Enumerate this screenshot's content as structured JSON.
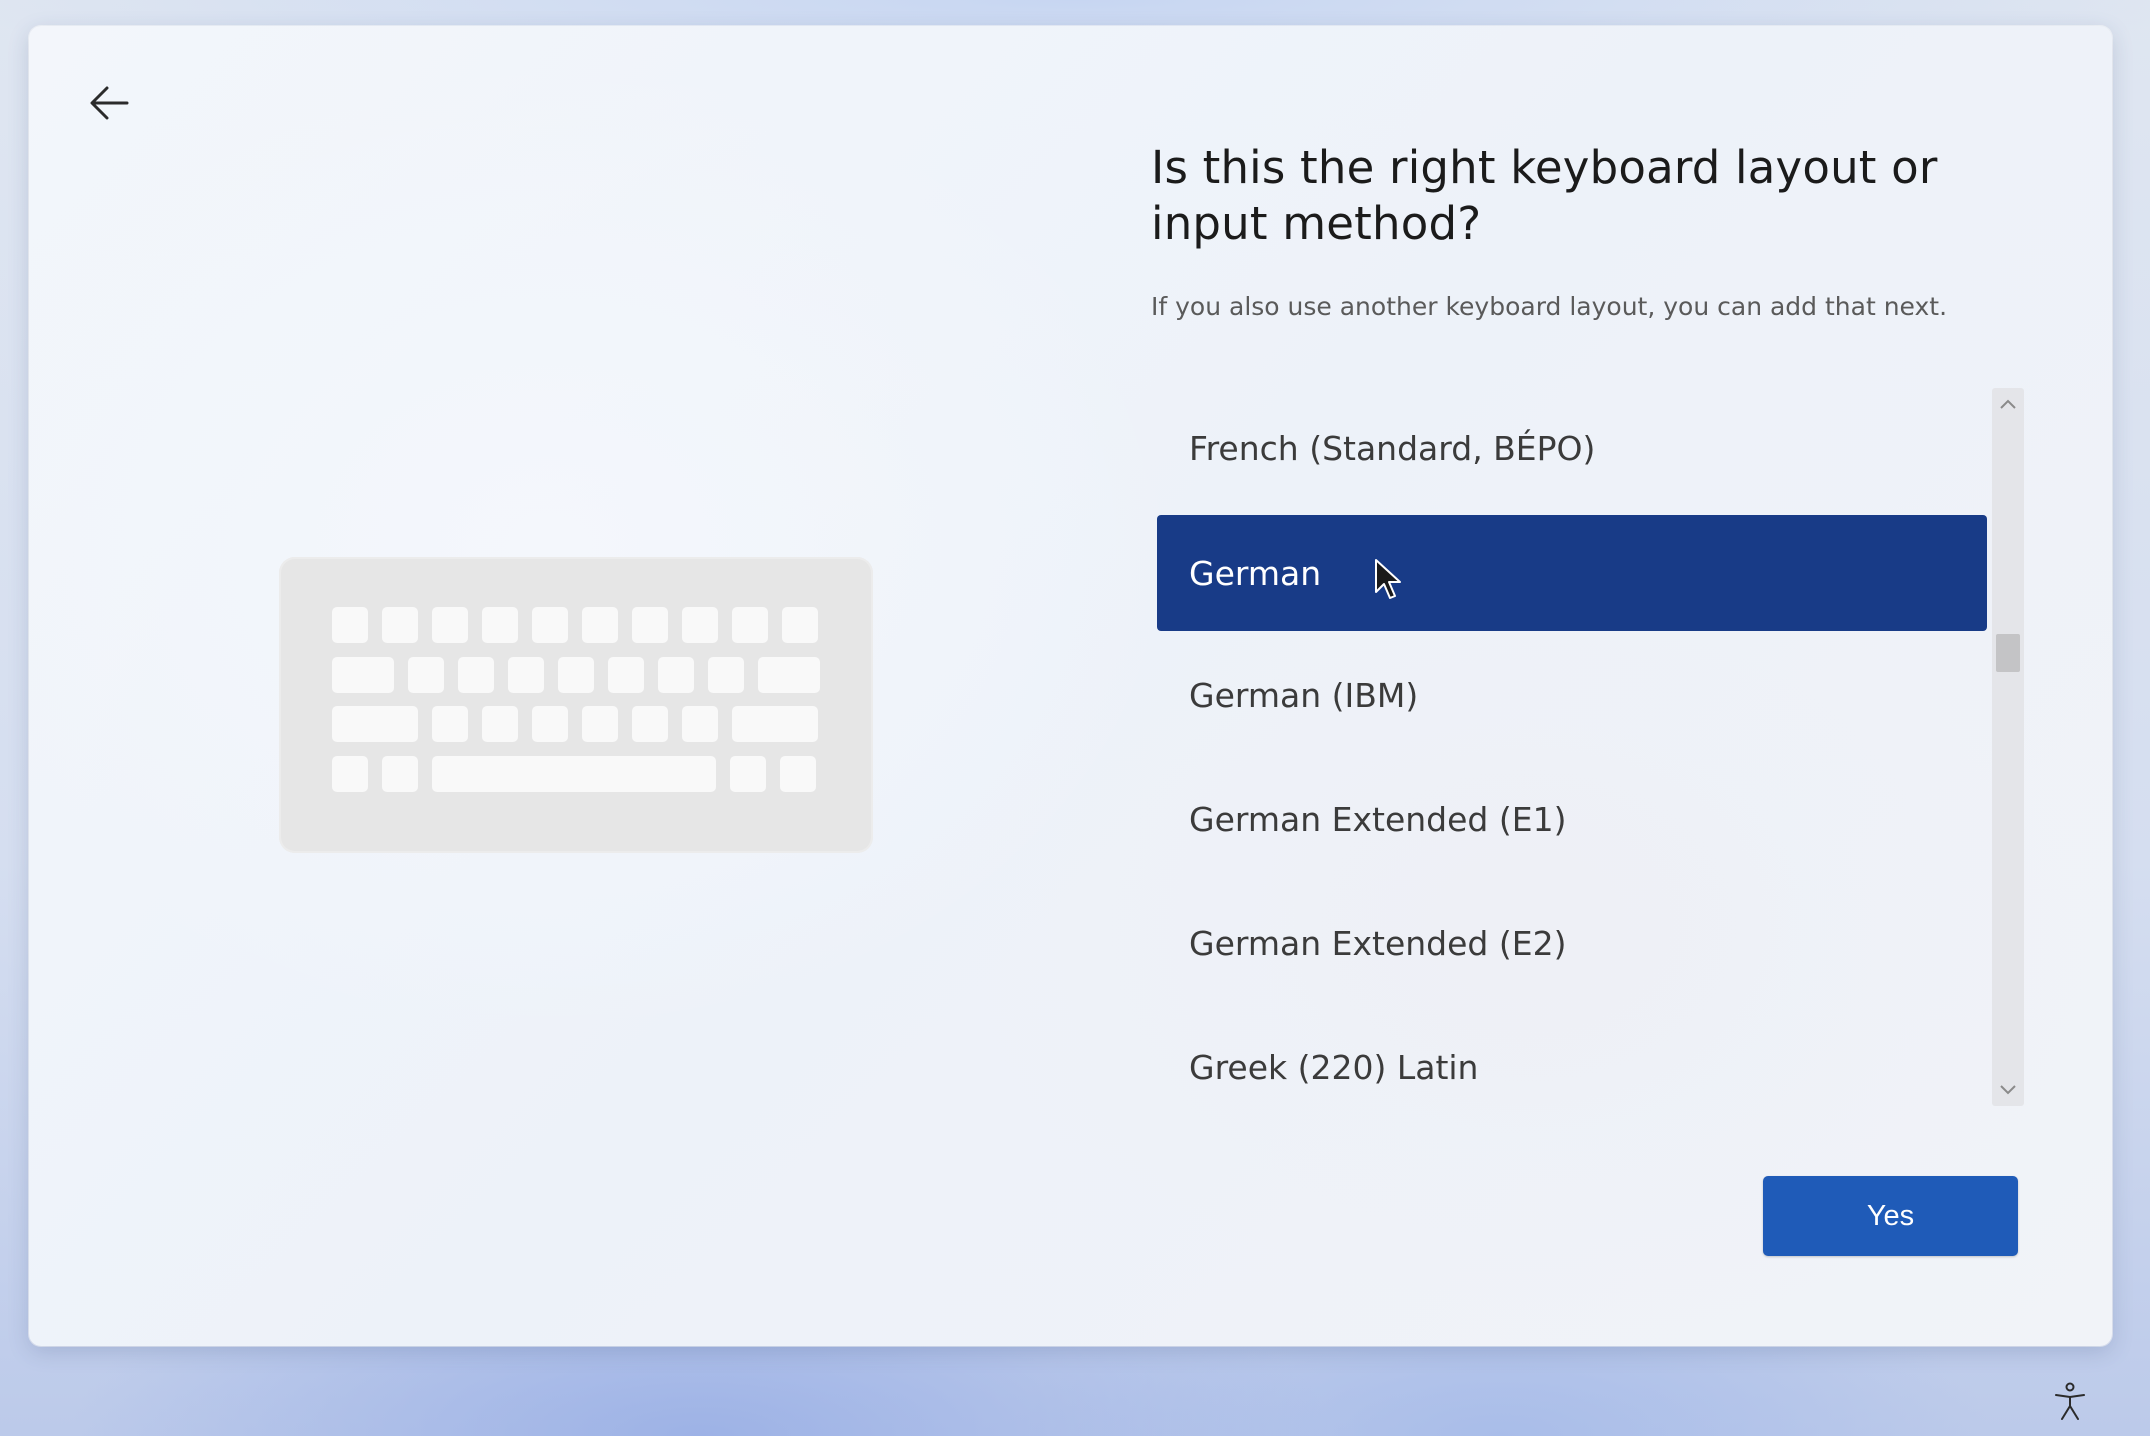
{
  "header": {
    "back_icon": "arrow-left-icon"
  },
  "main": {
    "illustration_icon": "keyboard-illustration",
    "title": "Is this the right keyboard layout or input method?",
    "subtitle": "If you also use another keyboard layout, you can add that next."
  },
  "layout_list": {
    "items": [
      {
        "label": "French (Standard, BÉPO)",
        "selected": false
      },
      {
        "label": "German",
        "selected": true
      },
      {
        "label": "German (IBM)",
        "selected": false
      },
      {
        "label": "German Extended (E1)",
        "selected": false
      },
      {
        "label": "German Extended (E2)",
        "selected": false
      },
      {
        "label": "Greek (220) Latin",
        "selected": false
      }
    ],
    "selected_color": "#183b87",
    "scroll_up_icon": "chevron-up-icon",
    "scroll_down_icon": "chevron-down-icon"
  },
  "actions": {
    "yes_label": "Yes",
    "yes_color": "#1f5bb8"
  },
  "footer": {
    "accessibility_icon": "accessibility-icon"
  }
}
